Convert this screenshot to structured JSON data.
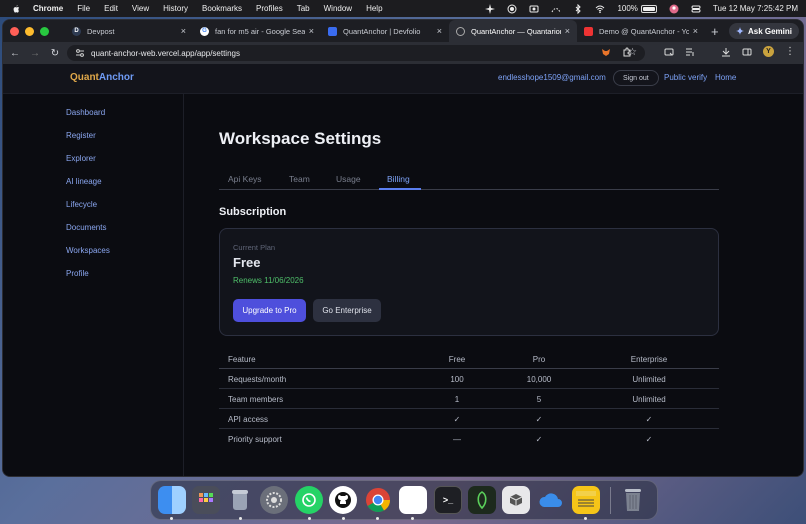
{
  "menubar": {
    "app": "Chrome",
    "menus": [
      "File",
      "Edit",
      "View",
      "History",
      "Bookmarks",
      "Profiles",
      "Tab",
      "Window",
      "Help"
    ],
    "battery": "100%",
    "clock": "Tue 12 May  7:25:42 PM"
  },
  "browser": {
    "tabs": [
      {
        "title": "Devpost",
        "favicon": "D",
        "color": "#2e3b52"
      },
      {
        "title": "fan for m5 air - Google Search",
        "favicon": "G",
        "color": "#ffffff"
      },
      {
        "title": "QuantAnchor | Devfolio",
        "favicon": "",
        "color": "#3a6cf0"
      },
      {
        "title": "QuantAnchor — Quantarions",
        "favicon": "",
        "color": "#8a8d96"
      },
      {
        "title": "Demo @ QuantAnchor - YouTube",
        "favicon": "",
        "color": "#e33"
      }
    ],
    "gemini_label": "Ask Gemini",
    "url": "quant-anchor-web.vercel.app/app/settings",
    "profile_initial": "Y"
  },
  "site": {
    "brand_part1": "Quant",
    "brand_part2": "Anchor",
    "email": "endlesshope1509@gmail.com",
    "signout": "Sign out",
    "public_verify": "Public verify",
    "home": "Home"
  },
  "sidebar": {
    "items": [
      "Dashboard",
      "Register",
      "Explorer",
      "AI lineage",
      "Lifecycle",
      "Documents",
      "Workspaces",
      "Profile"
    ]
  },
  "settings": {
    "title": "Workspace Settings",
    "tabs": [
      "Api Keys",
      "Team",
      "Usage",
      "Billing"
    ],
    "active_tab": "Billing",
    "subscription_heading": "Subscription",
    "current_plan_label": "Current Plan",
    "plan_name": "Free",
    "renews": "Renews 11/06/2026",
    "upgrade_button": "Upgrade to Pro",
    "enterprise_button": "Go Enterprise"
  },
  "features": {
    "headers": [
      "Feature",
      "Free",
      "Pro",
      "Enterprise"
    ],
    "rows": [
      [
        "Requests/month",
        "100",
        "10,000",
        "Unlimited"
      ],
      [
        "Team members",
        "1",
        "5",
        "Unlimited"
      ],
      [
        "API access",
        "✓",
        "✓",
        "✓"
      ],
      [
        "Priority support",
        "—",
        "✓",
        "✓"
      ]
    ]
  },
  "dock": {
    "apps": [
      "finder-icon",
      "launchpad-icon",
      "trash-app-icon",
      "system-settings-icon",
      "whatsapp-icon",
      "github-icon",
      "chrome-icon",
      "notes-white-icon",
      "terminal-icon",
      "bitdefender-icon",
      "cube-icon",
      "onedrive-icon",
      "notes-icon",
      "trash-icon"
    ]
  }
}
